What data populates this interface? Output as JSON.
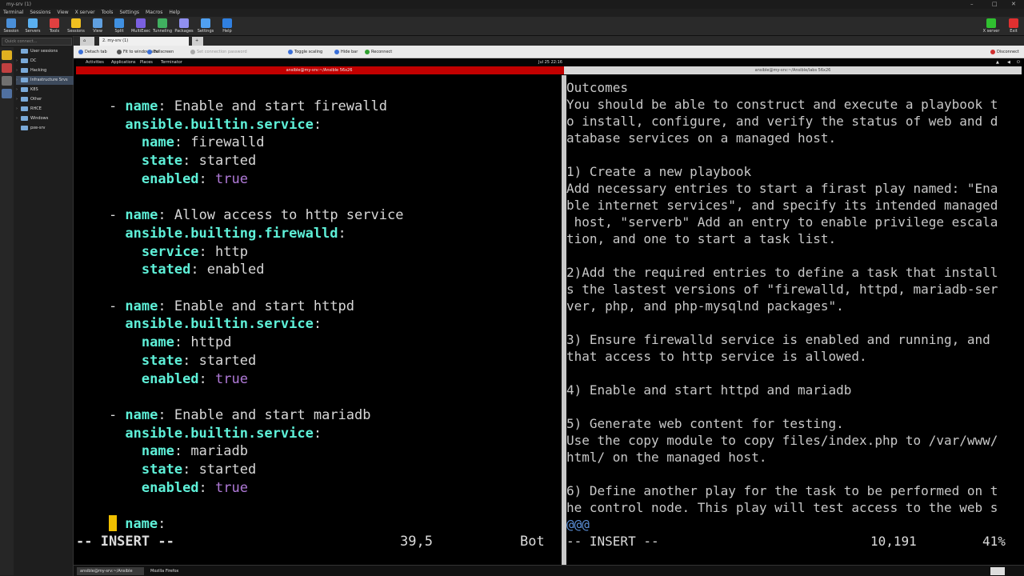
{
  "window": {
    "title": "my-srv (1)"
  },
  "menu": [
    "Terminal",
    "Sessions",
    "View",
    "X server",
    "Tools",
    "Settings",
    "Macros",
    "Help"
  ],
  "ribbon": [
    {
      "label": "Session",
      "color": "#4a8fd8"
    },
    {
      "label": "Servers",
      "color": "#5ab0f0"
    },
    {
      "label": "Tools",
      "color": "#e04040"
    },
    {
      "label": "Sessions",
      "color": "#f0c020"
    },
    {
      "label": "View",
      "color": "#60a0e0"
    },
    {
      "label": "Split",
      "color": "#4090e0"
    },
    {
      "label": "MultiExec",
      "color": "#7a60e0"
    },
    {
      "label": "Tunneling",
      "color": "#40b060"
    },
    {
      "label": "Packages",
      "color": "#9090f0"
    },
    {
      "label": "Settings",
      "color": "#50a0f0"
    },
    {
      "label": "Help",
      "color": "#3080e0"
    }
  ],
  "ribbon_right": [
    {
      "label": "X server",
      "color": "#30c030"
    },
    {
      "label": "Exit",
      "color": "#e03030"
    }
  ],
  "sidebar": {
    "quick_connect_placeholder": "Quick connect...",
    "items": [
      "User sessions",
      "DC",
      "Hacking",
      "Infrastructure Srvs",
      "K8S",
      "Other",
      "RHCE",
      "Windows",
      "pxe-srv"
    ]
  },
  "tabs": [
    "2. my-srv (1)"
  ],
  "toolbar": [
    "Detach tab",
    "Fit to window size",
    "Fullscreen",
    "Set connection password",
    "Toggle scaling",
    "Hide bar",
    "Reconnect",
    "Disconnect"
  ],
  "gnome": {
    "activities": "Activities",
    "applications": "Applications",
    "places": "Places",
    "terminator": "Terminator",
    "clock": "Jul 25  22:16"
  },
  "term_titles": {
    "left": "ansible@my-srv:~/Ansible 56x26",
    "right": "ansible@my-srv:~/Ansible/labs 56x26"
  },
  "left_pane": {
    "tasks": [
      {
        "name": "Enable and start firewalld",
        "module": "ansible.builtin.service",
        "args": [
          [
            "name",
            "firewalld",
            "s"
          ],
          [
            "state",
            "started",
            "s"
          ],
          [
            "enabled",
            "true",
            "b"
          ]
        ]
      },
      {
        "name": "Allow access to http service",
        "module": "ansible.builting.firewalld",
        "args": [
          [
            "service",
            "http",
            "s"
          ],
          [
            "stated",
            "enabled",
            "s"
          ]
        ]
      },
      {
        "name": "Enable and start httpd",
        "module": "ansible.builtin.service",
        "args": [
          [
            "name",
            "httpd",
            "s"
          ],
          [
            "state",
            "started",
            "s"
          ],
          [
            "enabled",
            "true",
            "b"
          ]
        ]
      },
      {
        "name": "Enable and start mariadb",
        "module": "ansible.builtin.service",
        "args": [
          [
            "name",
            "mariadb",
            "s"
          ],
          [
            "state",
            "started",
            "s"
          ],
          [
            "enabled",
            "true",
            "b"
          ]
        ]
      }
    ],
    "last_line_key": "name",
    "mode": "-- INSERT --",
    "position": "39,5",
    "scroll": "Bot"
  },
  "right_pane": {
    "lines": [
      "Outcomes",
      "You should be able to construct and execute a playbook t",
      "o install, configure, and verify the status of web and d",
      "atabase services on a managed host.",
      "",
      "1) Create a new playbook",
      "Add necessary entries to start a firast play named: \"Ena",
      "ble internet services\", and specify its intended managed",
      " host, \"serverb\" Add an entry to enable privilege escala",
      "tion, and one to start a task list.",
      "",
      "2)Add the required entries to define a task that install",
      "s the lastest versions of \"firewalld, httpd, mariadb-ser",
      "ver, php, and php-mysqlnd packages\".",
      "",
      "3) Ensure firewalld service is enabled and running, and",
      "that access to http service is allowed.",
      "",
      "4) Enable and start httpd and mariadb",
      "",
      "5) Generate web content for testing.",
      "Use the copy module to copy files/index.php to /var/www/",
      "html/ on the managed host.",
      "",
      "6) Define another play for the task to be performed on t",
      "he control node. This play will test access to the web s",
      "@@@"
    ],
    "mode": "-- INSERT --",
    "position": "10,191",
    "scroll": "41%"
  },
  "taskbar": [
    "ansible@my-srv:~/Ansible",
    "Mozilla Firefox"
  ]
}
